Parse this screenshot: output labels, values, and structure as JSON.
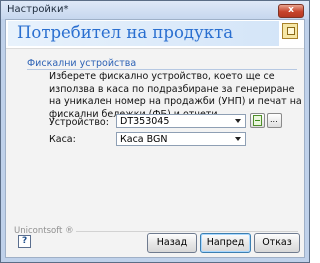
{
  "window": {
    "title": "Настройки*",
    "close_label": "x"
  },
  "header": {
    "title": "Потребител на продукта",
    "icon": "wizard-logo-icon"
  },
  "section": {
    "title": "Фискални устройства",
    "description": "Изберете фискално устройство, което ще се използва в каса по подразбиране за генериране на уникален номер на продажби (УНП) и печат на фискални бележки (ФБ) и отчети."
  },
  "form": {
    "device_label": "Устройство:",
    "device_value": "DT353045",
    "refresh_icon": "refresh-icon",
    "browse_label": "...",
    "register_label": "Каса:",
    "register_value": "Каса BGN"
  },
  "footer": {
    "brand": "Unicontsoft ®",
    "help_icon": "help-icon",
    "help_glyph": "?",
    "back_label": "Назад",
    "next_label": "Напред",
    "cancel_label": "Отказ"
  }
}
